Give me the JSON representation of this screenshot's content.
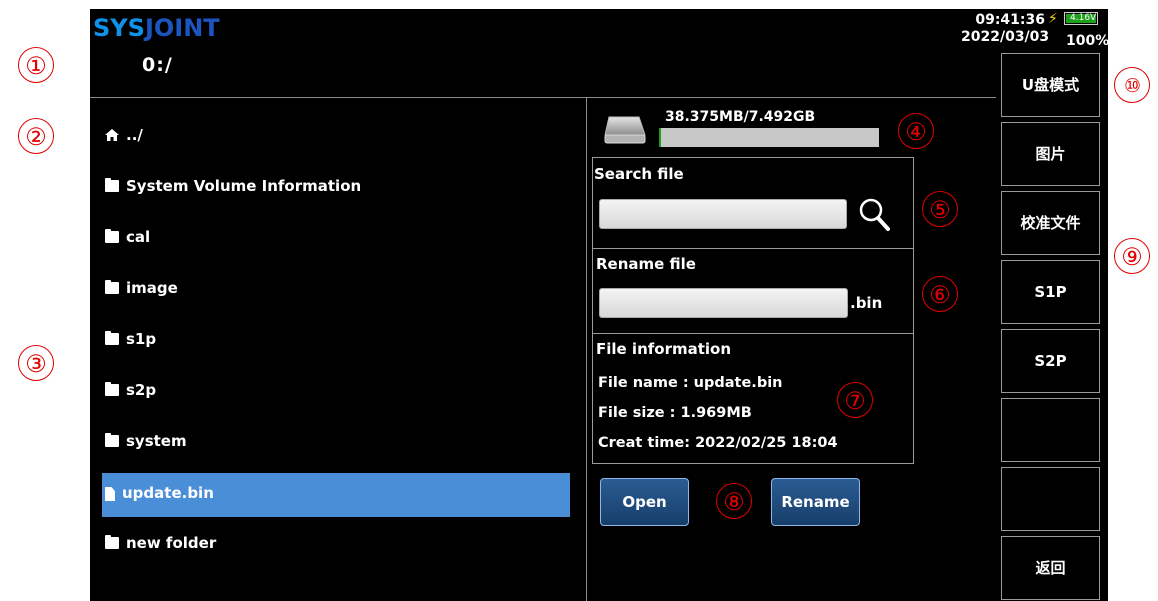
{
  "brand": {
    "logo_part1": "SYS",
    "logo_part2": "JOINT"
  },
  "header": {
    "current_path": "0:/"
  },
  "status": {
    "time": "09:41:36",
    "date": "2022/03/03",
    "battery_voltage": "4.16V",
    "battery_percent": "100%",
    "battery_level": 1.0,
    "charging": true
  },
  "file_list": [
    {
      "icon": "home-icon",
      "label": "../"
    },
    {
      "icon": "folder-icon",
      "label": "System Volume Information"
    },
    {
      "icon": "folder-icon",
      "label": "cal"
    },
    {
      "icon": "folder-icon",
      "label": "image"
    },
    {
      "icon": "folder-icon",
      "label": "s1p"
    },
    {
      "icon": "folder-icon",
      "label": "s2p"
    },
    {
      "icon": "folder-icon",
      "label": "system"
    },
    {
      "icon": "file-icon",
      "label": "update.bin",
      "selected": true
    },
    {
      "icon": "folder-icon",
      "label": "new folder"
    }
  ],
  "storage": {
    "text": "38.375MB/7.492GB",
    "used_fraction": 0.005
  },
  "search": {
    "title": "Search file",
    "value": "",
    "placeholder": ""
  },
  "rename": {
    "title": "Rename file",
    "value": "",
    "extension": ".bin"
  },
  "file_info": {
    "title": "File information",
    "name_line": "File name : update.bin",
    "size_line": "File size   : 1.969MB",
    "time_line": "Creat time: 2022/02/25 18:04"
  },
  "buttons": {
    "open": "Open",
    "rename": "Rename"
  },
  "softkeys": [
    "U盘模式",
    "图片",
    "校准文件",
    "S1P",
    "S2P",
    "",
    "",
    "返回"
  ],
  "callouts": [
    "①",
    "②",
    "③",
    "④",
    "⑤",
    "⑥",
    "⑦",
    "⑧",
    "⑨",
    "⑩"
  ],
  "colors": {
    "selection": "#4b8ed8",
    "logo_light": "#0f93ea",
    "logo_dark": "#1c55c0",
    "callout": "#e00000",
    "storage_fill": "#1aa01a"
  }
}
